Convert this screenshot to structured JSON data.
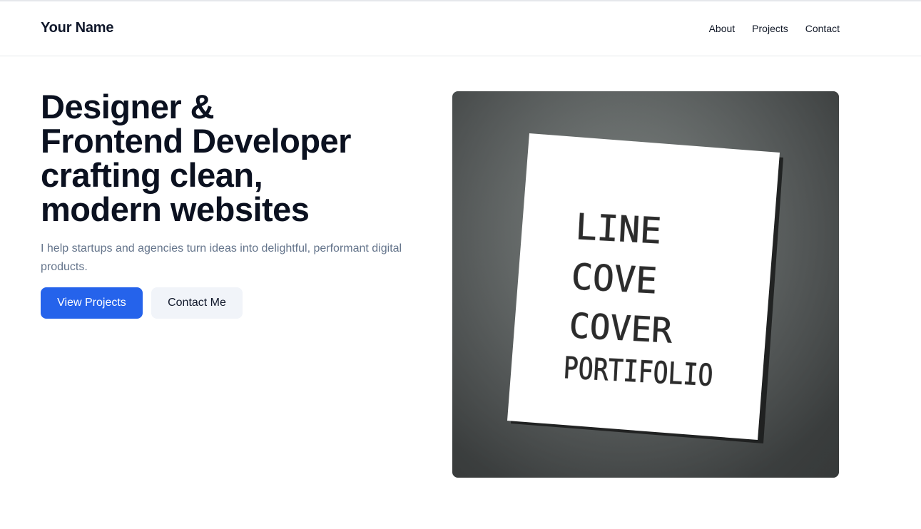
{
  "header": {
    "brand": "Your Name",
    "nav": [
      {
        "label": "About"
      },
      {
        "label": "Projects"
      },
      {
        "label": "Contact"
      }
    ]
  },
  "hero": {
    "title_lines": [
      "Designer &",
      "Frontend Developer",
      "crafting clean,",
      "modern websites"
    ],
    "subtitle": "I help startups and agencies turn ideas into delightful, performant digital products.",
    "primary_button": "View Projects",
    "secondary_button": "Contact Me"
  },
  "image": {
    "paper_lines": [
      "LINE",
      "COVE",
      "COVER",
      "PORTIFOLIO"
    ]
  },
  "colors": {
    "accent": "#2563eb",
    "text": "#0f172a",
    "muted": "#64748b",
    "secondary_bg": "#f1f4f9"
  }
}
